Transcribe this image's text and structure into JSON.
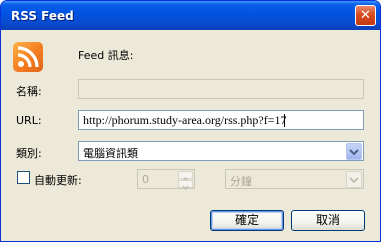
{
  "window": {
    "title": "RSS Feed",
    "close_label": "✕"
  },
  "header": {
    "feed_info_label": "Feed 訊息:"
  },
  "form": {
    "name_label": "名稱:",
    "name_value": "",
    "url_label": "URL:",
    "url_value": "http://phorum.study-area.org/rss.php?f=17",
    "category_label": "類別:",
    "category_value": "電腦資訊類",
    "auto_update_label": "自動更新:",
    "auto_update_checked": false,
    "interval_value": "0",
    "interval_unit": "分鐘"
  },
  "buttons": {
    "ok_label": "確定",
    "cancel_label": "取消"
  },
  "colors": {
    "titlebar": "#0054e3",
    "dialog_bg": "#ece9d8",
    "rss_orange": "#f47c20"
  },
  "icons": {
    "feed": "rss-icon",
    "close": "close-icon",
    "dropdown": "chevron-down-icon"
  }
}
